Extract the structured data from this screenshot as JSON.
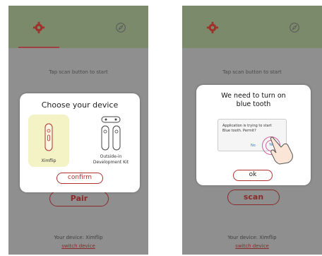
{
  "left_screen": {
    "hint": "Tap scan button to start",
    "dialog": {
      "title": "Choose your device",
      "options": [
        {
          "label": "Ximflip",
          "selected": true
        },
        {
          "label": "Outside-in Development Kit",
          "selected": false
        }
      ],
      "confirm_label": "confirm"
    },
    "under_button_label": "Pair",
    "device_text": "Your device: Ximflip",
    "switch_label": "switch device"
  },
  "right_screen": {
    "hint": "Tap scan button to start",
    "dialog": {
      "title_line1": "We need to turn on",
      "title_line2": "blue tooth",
      "alert_line1": "Application is trying to start",
      "alert_line2": "Blue tooth. Permit?",
      "no_label": "No",
      "yes_label": "Yes",
      "ok_label": "ok"
    },
    "scan_label": "scan",
    "device_text": "Your device: Ximflip",
    "switch_label": "switch device"
  },
  "icons": {
    "tab_settings": "gear-icon",
    "tab_explore": "compass-icon"
  },
  "colors": {
    "topbar": "#7c8a6c",
    "background_dim": "#8f8f8f",
    "accent": "#b23030",
    "selected_option": "#f4f3c6"
  }
}
